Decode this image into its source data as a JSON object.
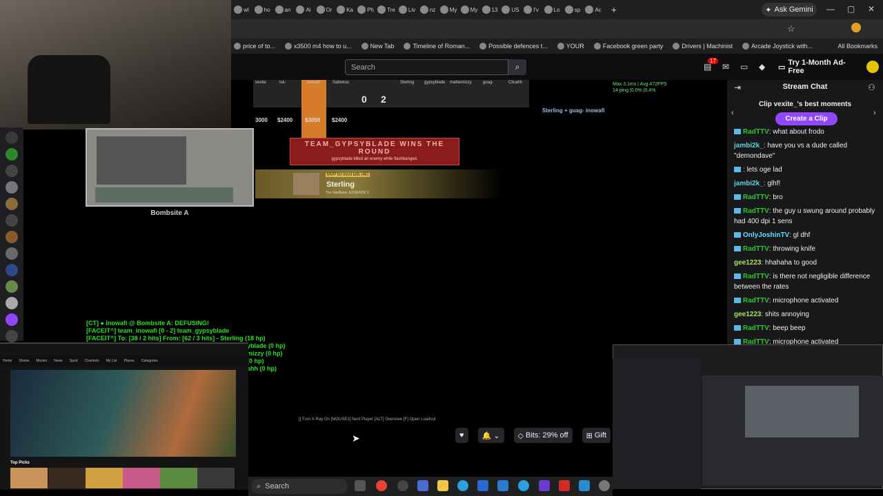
{
  "browser": {
    "tabs": [
      {
        "label": "wl"
      },
      {
        "label": "ho"
      },
      {
        "label": "an"
      },
      {
        "label": "Ai"
      },
      {
        "label": "Or"
      },
      {
        "label": "Ka"
      },
      {
        "label": "Ph"
      },
      {
        "label": "Tre"
      },
      {
        "label": "Liv"
      },
      {
        "label": "nz"
      },
      {
        "label": "My"
      },
      {
        "label": "My"
      },
      {
        "label": "13"
      },
      {
        "label": "US"
      },
      {
        "label": "I'v"
      },
      {
        "label": "Lo"
      },
      {
        "label": "sp"
      },
      {
        "label": "Ac"
      }
    ],
    "new_tab": "+",
    "gemini_label": "Ask Gemini",
    "bookmarks": [
      {
        "label": "price of to..."
      },
      {
        "label": "x3500 m4 how to u..."
      },
      {
        "label": "New Tab"
      },
      {
        "label": "Timeline of Roman..."
      },
      {
        "label": "Possible defences t..."
      },
      {
        "label": "YOUR"
      },
      {
        "label": "Facebook green party"
      },
      {
        "label": "Drivers | Machinist"
      },
      {
        "label": "Arcade Joystick with..."
      }
    ],
    "all_bookmarks": "All Bookmarks"
  },
  "twitch_header": {
    "search_placeholder": "Search",
    "notifications_count": "17",
    "adfree_label": "Try 1-Month Ad-Free"
  },
  "game": {
    "scoreboard_names": [
      "vexite",
      "tsk-",
      "inowafi",
      "Sabretus",
      "Sterling",
      "gypsyblade",
      "mattiemizzy",
      "guag-",
      "Clicahh"
    ],
    "money": [
      "3000",
      "$2400",
      "$3050",
      "$2400"
    ],
    "score_ct": "0",
    "score_t": "2",
    "round_win_title": "TEAM_GYPSYBLADE WINS THE ROUND",
    "round_win_sub": "gypsyblade killed an enemy while flashbanged.",
    "mvp_label": "MVP for most kills (4k)",
    "mvp_name": "Sterling",
    "mvp_team": "The Vanillians, E2/SENCE 2",
    "fps_line1": "Max 3.1ms | Avg 472FPS",
    "fps_line2": "14 ping  |0.0%  |0.4%",
    "killfeed": "Sterling + guag-          inowafi",
    "bombsite_label": "Bombsite A",
    "console": [
      "[CT] ● Inowafi @ Bombsite A: DEFUSING!",
      "[FACEIT^] team_inowafi [0 - 2] team_gypsyblade",
      "[FACEIT^] To: [38 / 2 hits] From: [62 / 3 hits] - Sterling (18 hp)",
      "yblade (0 hp)",
      "mizzy (0 hp)",
      "(0 hp)",
      "ahh (0 hp)"
    ],
    "hint_bar": "[] Turn X-Ray On   [MOUSE1] Next Player   [ALT] Overview   [F] Open Loadout"
  },
  "player_controls": {
    "bits_label": "Bits: 29% off",
    "gift_label": "Gift"
  },
  "chat": {
    "title": "Stream Chat",
    "clip_promo": "Clip vexite_'s best moments",
    "clip_button": "Create a Clip",
    "messages": [
      {
        "user": "RadTTV",
        "color": "#2fc62f",
        "badge": true,
        "text": "what about frodo"
      },
      {
        "user": "jambi2k_",
        "color": "#5fd4d4",
        "badge": false,
        "text": "have you vs a dude called \"demondave\""
      },
      {
        "user": "",
        "color": "#2a2aff",
        "badge": true,
        "text": "lets oge lad"
      },
      {
        "user": "jambi2k_",
        "color": "#5fd4d4",
        "badge": false,
        "text": "glhf!"
      },
      {
        "user": "RadTTV",
        "color": "#2fc62f",
        "badge": true,
        "text": "bro"
      },
      {
        "user": "RadTTV",
        "color": "#2fc62f",
        "badge": true,
        "text": "the guy u swung around probably had 400 dpi 1 sens"
      },
      {
        "user": "OnlyJoshinTV",
        "color": "#5fe0ff",
        "badge": true,
        "text": "gl dhf"
      },
      {
        "user": "RadTTV",
        "color": "#2fc62f",
        "badge": true,
        "text": "throwing knife"
      },
      {
        "user": "gee1223",
        "color": "#a8e05f",
        "badge": false,
        "text": "hhahaha to good"
      },
      {
        "user": "RadTTV",
        "color": "#2fc62f",
        "badge": true,
        "text": "is there not negligible difference between the rates"
      },
      {
        "user": "RadTTV",
        "color": "#2fc62f",
        "badge": true,
        "text": "microphone activated"
      },
      {
        "user": "gee1223",
        "color": "#a8e05f",
        "badge": false,
        "text": "shits annoying"
      },
      {
        "user": "RadTTV",
        "color": "#2fc62f",
        "badge": true,
        "text": "beep beep"
      },
      {
        "user": "RadTTV",
        "color": "#2fc62f",
        "badge": true,
        "text": "microphone activated"
      }
    ]
  },
  "left_window": {
    "nav": [
      "Home",
      "Shows",
      "Movies",
      "News",
      "Sport",
      "Channels",
      "My List",
      "Places",
      "Categories"
    ],
    "top_picks": "Top Picks"
  },
  "taskbar": {
    "search_label": "Search"
  }
}
